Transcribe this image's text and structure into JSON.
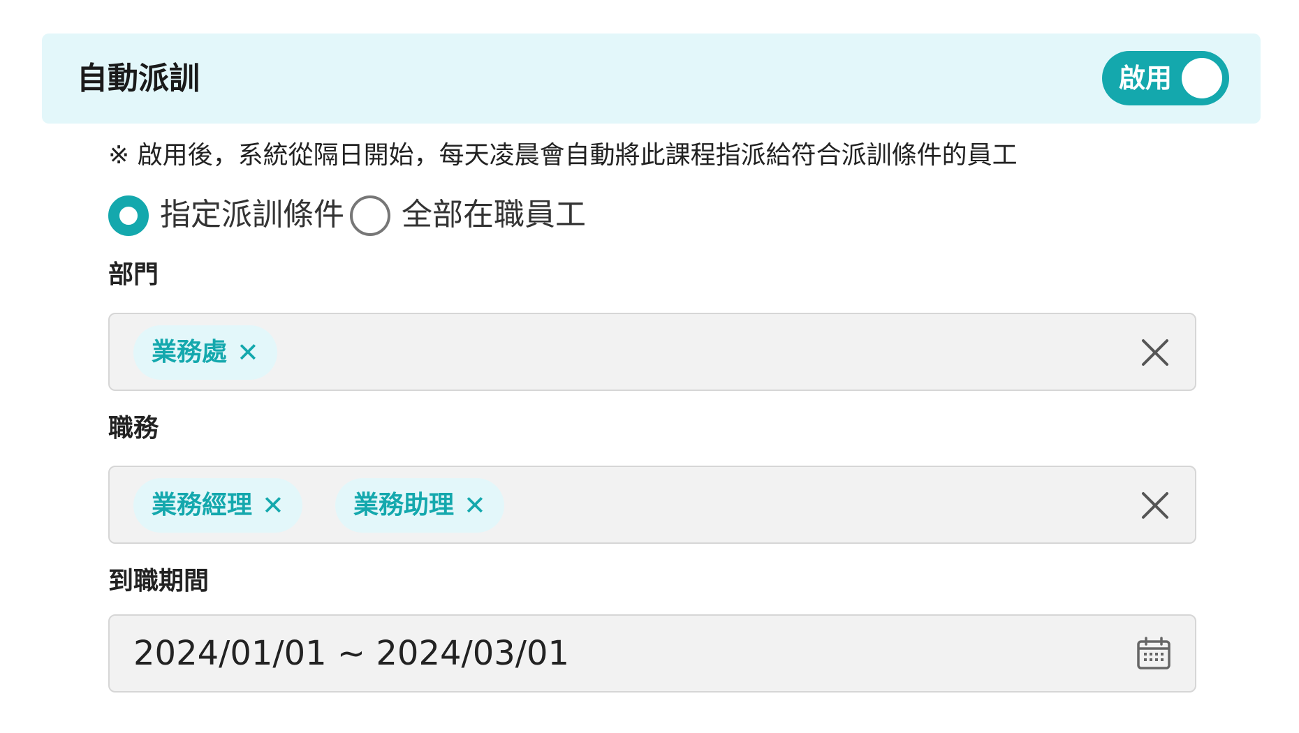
{
  "header": {
    "title": "自動派訓",
    "toggle_label": "啟用",
    "toggle_on": true,
    "accent_color": "#14a8ad",
    "background_color": "#e3f7fa"
  },
  "note": "※ 啟用後，系統從隔日開始，每天凌晨會自動將此課程指派給符合派訓條件的員工",
  "assignment_mode": {
    "options": [
      {
        "label": "指定派訓條件",
        "selected": true
      },
      {
        "label": "全部在職員工",
        "selected": false
      }
    ]
  },
  "department": {
    "label": "部門",
    "tags": [
      "業務處"
    ],
    "clear_icon": "close-icon"
  },
  "position": {
    "label": "職務",
    "tags": [
      "業務經理",
      "業務助理"
    ],
    "clear_icon": "close-icon"
  },
  "hire_period": {
    "label": "到職期間",
    "value": "2024/01/01 ~ 2024/03/01",
    "icon": "calendar-icon"
  },
  "icons": {
    "tag_remove": "✕"
  }
}
